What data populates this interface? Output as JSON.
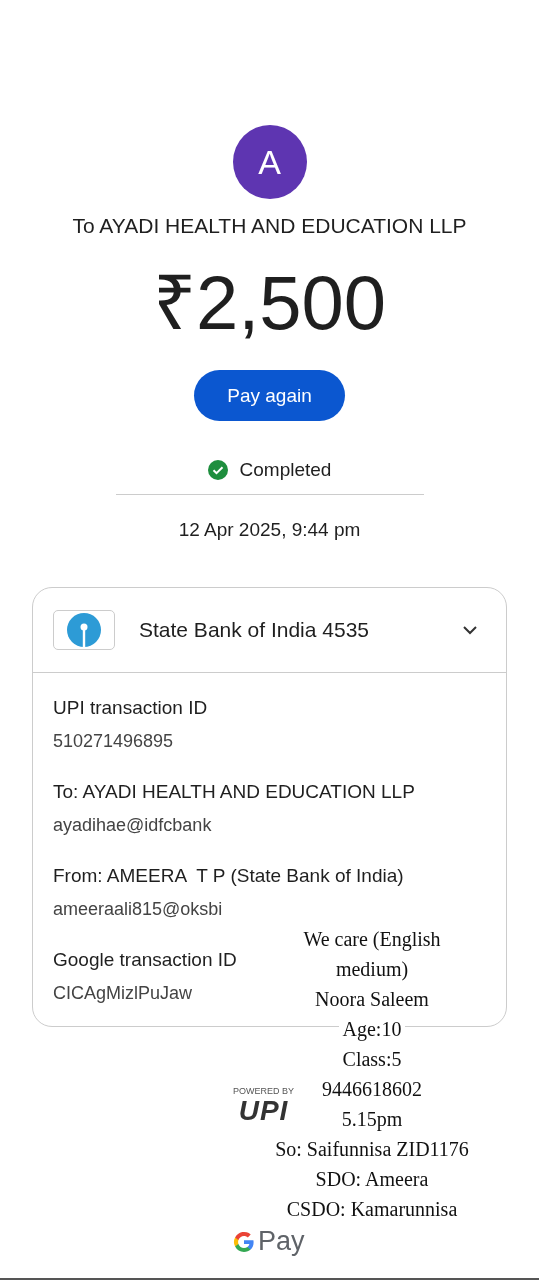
{
  "payee_avatar": {
    "initial": "A"
  },
  "title": "To AYADI HEALTH AND EDUCATION LLP",
  "amount": "₹2,500",
  "pay_again_button": "Pay again",
  "status": {
    "kind": "completed",
    "label": "Completed"
  },
  "date": "12 Apr 2025, 9:44 pm",
  "account": {
    "name": "State Bank of India 4535",
    "expanded": true
  },
  "details": [
    {
      "label": "UPI transaction ID",
      "value": "510271496895"
    },
    {
      "label": "To: AYADI HEALTH AND EDUCATION LLP",
      "value": "ayadihae@idfcbank"
    },
    {
      "label": "From: AMEERA  T P (State Bank of India)",
      "value": "ameeraali815@oksbi"
    },
    {
      "label": "Google transaction ID",
      "value": "CICAgMizlPuJaw"
    }
  ],
  "upi_badge": {
    "caption": "POWERED BY",
    "logo": "UPI"
  },
  "brand": {
    "name": "Pay"
  },
  "note": {
    "lines": [
      "We care (English",
      "medium)",
      "Noora Saleem",
      "Age:10",
      "Class:5",
      "9446618602",
      "5.15pm",
      "So: Saifunnisa ZID1176",
      "SDO: Ameera",
      "CSDO: Kamarunnisa"
    ]
  }
}
